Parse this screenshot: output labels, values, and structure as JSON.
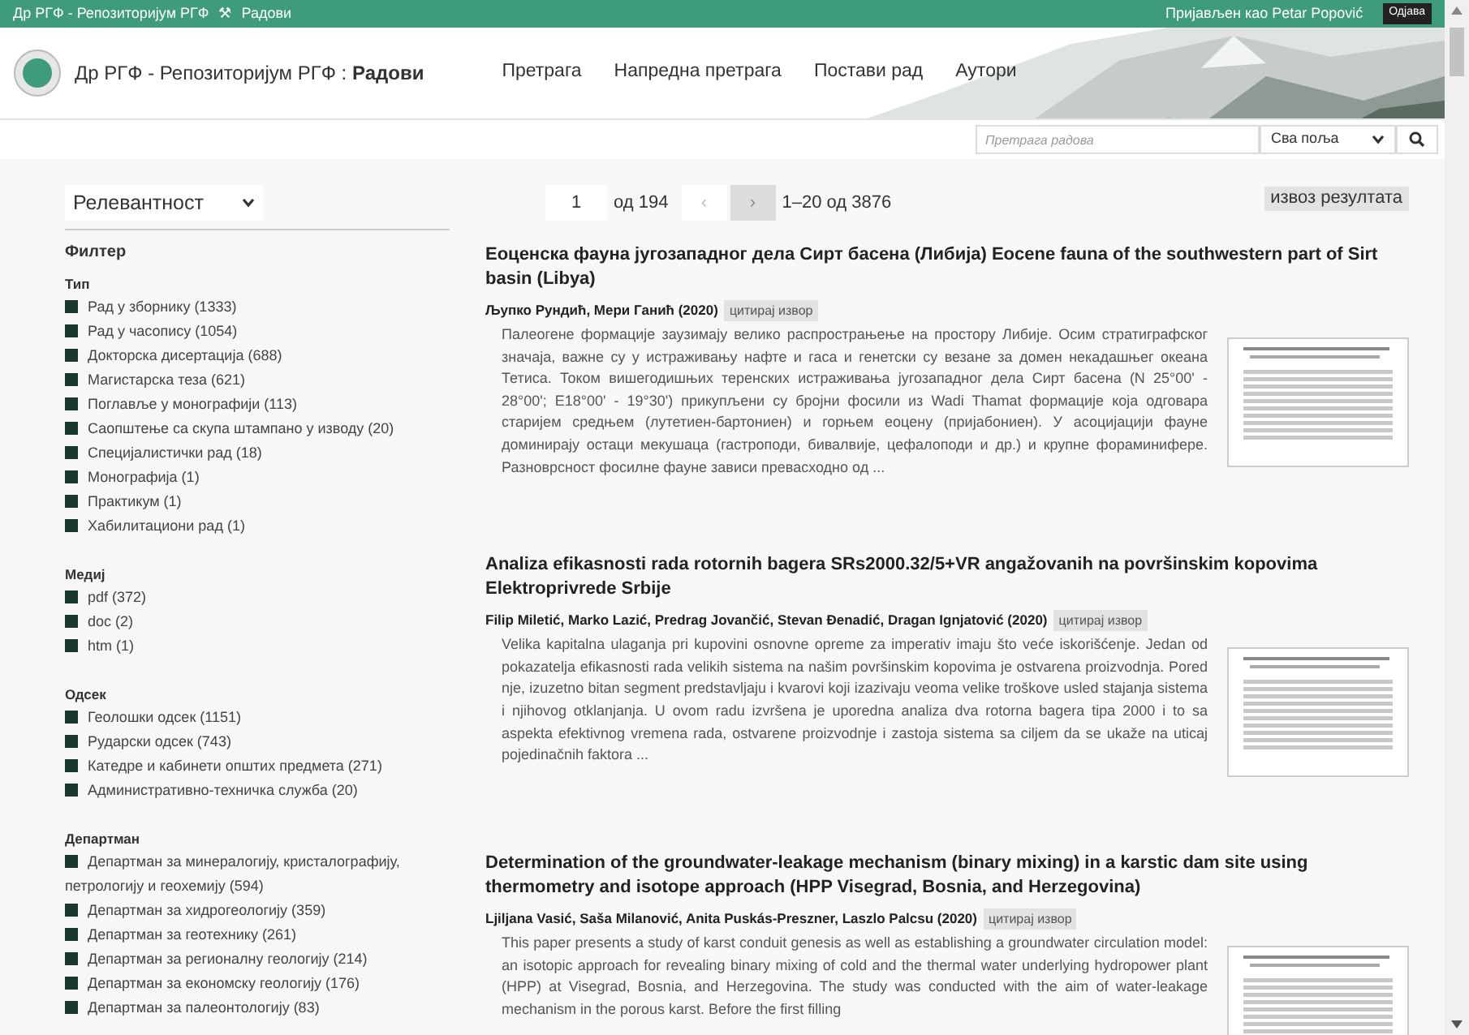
{
  "top_bar": {
    "breadcrumb": "Др РГФ - Репозиторијум РГФ",
    "separator_icon": "⚒",
    "section": "Радови",
    "logged_in": "Пријављен као Petar Popović",
    "logout": "Одјава"
  },
  "header": {
    "site_title": "Др РГФ - Репозиторијум РГФ :",
    "site_section": "Радови",
    "nav": [
      {
        "label": "Претрага"
      },
      {
        "label": "Напредна претрага"
      },
      {
        "label": "Постави рад"
      },
      {
        "label": "Аутори"
      }
    ]
  },
  "search": {
    "placeholder": "Претрага радова",
    "field_select": "Сва поља"
  },
  "sort": "Релевантност",
  "filter_title": "Филтер",
  "filter_groups": [
    {
      "title": "Тип",
      "items": [
        "Рад у зборнику (1333)",
        "Рад у часопису (1054)",
        "Докторска дисертација (688)",
        "Магистарска теза (621)",
        "Поглавље у монографији (113)",
        "Саопштење са скупа штампано у изводу (20)",
        "Специјалистички рад (18)",
        "Монографија (1)",
        "Практикум (1)",
        "Хабилитациони рад (1)"
      ]
    },
    {
      "title": "Медиј",
      "items": [
        "pdf (372)",
        "doc (2)",
        "htm (1)"
      ]
    },
    {
      "title": "Одсек",
      "items": [
        "Геолошки одсек (1151)",
        "Рударски одсек (743)",
        "Катедре и кабинети општих предмета (271)",
        "Административно-техничка служба (20)"
      ]
    },
    {
      "title": "Департман",
      "items": [
        "Департман за минералогију, кристалографију, петрологију и геохемију (594)",
        "Департман за хидрогеологију (359)",
        "Департман за геотехнику (261)",
        "Департман за регионалну геологију (214)",
        "Департман за економску геологију (176)",
        "Департман за палеонтологију (83)"
      ]
    }
  ],
  "pagination": {
    "page": "1",
    "of_pages": "од 194",
    "prev": "‹",
    "next": "›",
    "range": "1–20 од 3876",
    "export": "извоз резултата"
  },
  "results": [
    {
      "title": "Еоценска фауна југозападног дела Сирт басена (Либија) Eocene fauna of the southwestern part of Sirt basin (Libya)",
      "authors": "Љупко Рундић, Мери Ганић (2020)",
      "cite": "цитирај извор",
      "abstract": "Палеогене формације заузимају велико распрострањење на простору Либије. Осим стратиграфског значаја, важне су у истраживању нафте и гаса и генетски су везане за домен некадашњег океана Тетиса. Током вишегодишњих теренских истраживања југозападног дела Сирт басена (N 25°00' - 28°00'; E18°00' - 19°30') прикупљени су бројни фосили из Wadi Thamat формације која одговара старијем средњем (лутетиен-бартониен) и горњем еоцену (пријабониен). У асоцијацији фауне доминирају остаци мекушаца (гастроподи, бивалвије, цефалоподи и др.) и крупне фораминифере. Разноврсност фосилне фауне зависи превасходно од ..."
    },
    {
      "title": "Analiza efikasnosti rada rotornih bagera SRs2000.32/5+VR angažovanih na površinskim kopovima Elektroprivrede Srbije",
      "authors": "Filip Miletić, Marko Lazić, Predrag Jovančić, Stevan Đenadić, Dragan Ignjatović (2020)",
      "cite": "цитирај извор",
      "abstract": "Velika kapitalna ulaganja pri kupovini osnovne opreme za imperativ imaju što veće iskorišćenje. Jedan od pokazatelja efikasnosti rada velikih sistema na našim površinskim kopovima je ostvarena proizvodnja. Pored nje, izuzetno bitan segment predstavljaju i kvarovi koji izazivaju veoma velike troškove usled stajanja sistema i njihovog otklanjanja. U ovom radu izvršena je uporedna analiza dva rotorna bagera tipa 2000 i to sa aspekta efektivnog vremena rada, ostvarene proizvodnje i zastoja sistema sa ciljem da se ukaže na uticaj pojedinačnih faktora ..."
    },
    {
      "title": "Determination of the groundwater-leakage mechanism (binary mixing) in a karstic dam site using thermometry and isotope approach (HPP Visegrad, Bosnia, and Herzegovina)",
      "authors": "Ljiljana Vasić, Saša Milanović, Anita Puskás-Preszner, Laszlo Palcsu (2020)",
      "cite": "цитирај извор",
      "abstract": "This paper presents a study of karst conduit genesis as well as establishing a groundwater circulation model: an isotopic approach for revealing binary mixing of cold and the thermal water underlying hydropower plant (HPP) at Visegrad, Bosnia, and Herzegovina. The study was conducted with the aim of water-leakage mechanism in the porous karst. Before the first filling"
    }
  ]
}
